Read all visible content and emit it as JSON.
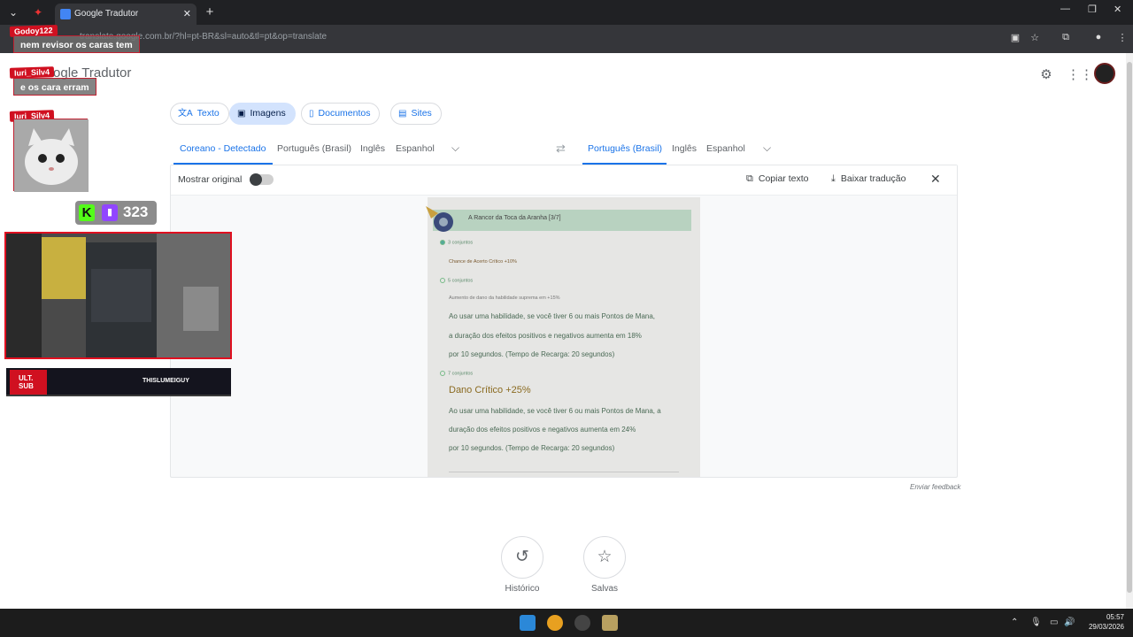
{
  "browser": {
    "tab_title": "Google Tradutor",
    "url": "translate.google.com.br/?hl=pt-BR&sl=auto&tl=pt&op=translate"
  },
  "header": {
    "logo_text": "Google Tradutor"
  },
  "mode_tabs": [
    {
      "label": "Texto",
      "icon": "translate-icon"
    },
    {
      "label": "Imagens",
      "icon": "image-icon"
    },
    {
      "label": "Documentos",
      "icon": "document-icon"
    },
    {
      "label": "Sites",
      "icon": "web-icon"
    }
  ],
  "source_langs": [
    "Coreano - Detectado",
    "Português (Brasil)",
    "Inglês",
    "Espanhol"
  ],
  "target_langs": [
    "Português (Brasil)",
    "Inglês",
    "Espanhol"
  ],
  "panel": {
    "show_original": "Mostrar original",
    "copy_text": "Copiar texto",
    "download": "Baixar tradução"
  },
  "image_content": {
    "header": "A Rancor da Toca da Aranha [3/7]",
    "set3": "3 conjuntos",
    "set3_effect": "Chance de Acerto Crítico +10%",
    "set5": "5 conjuntos",
    "set5_effect": "Aumento de dano da habilidade suprema em +15%",
    "set5_line1": "Ao usar uma habilidade, se você tiver 6 ou mais Pontos de Mana,",
    "set5_line2": "a duração dos efeitos positivos e negativos aumenta em 18%",
    "set5_line3": "por 10 segundos. (Tempo de Recarga: 20 segundos)",
    "set7": "7 conjuntos",
    "set7_title": "Dano Crítico +25%",
    "set7_line1": "Ao usar uma habilidade, se você tiver 6 ou mais Pontos de Mana, a",
    "set7_line2": "duração dos efeitos positivos e negativos aumenta em 24%",
    "set7_line3": "por 10 segundos. (Tempo de Recarga: 20 segundos)"
  },
  "feedback": "Enviar feedback",
  "bottom": {
    "history": "Histórico",
    "saved": "Salvas"
  },
  "taskbar": {
    "time": "05:57",
    "date": "29/03/2026"
  },
  "overlay": {
    "chat": [
      {
        "user": "Godoy122",
        "msg": "nem revisor os caras tem"
      },
      {
        "user": "Iuri_Silv4",
        "msg": "e os cara erram"
      },
      {
        "user": "Iuri_Silv4",
        "msg": ""
      }
    ],
    "follower_count": "323",
    "sub_label": "ULT. SUB",
    "sub_name": "THISLUMEIGUY"
  },
  "colors": {
    "accent": "#1a73e8",
    "active_chip": "#d3e3fd",
    "overlay_red": "#d01020"
  }
}
